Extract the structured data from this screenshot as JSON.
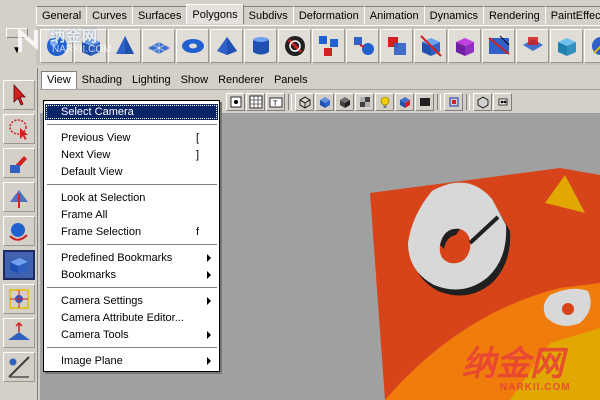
{
  "shelf": {
    "tabs": [
      {
        "label": "General",
        "active": false
      },
      {
        "label": "Curves",
        "active": false
      },
      {
        "label": "Surfaces",
        "active": false
      },
      {
        "label": "Polygons",
        "active": true
      },
      {
        "label": "Subdivs",
        "active": false
      },
      {
        "label": "Deformation",
        "active": false
      },
      {
        "label": "Animation",
        "active": false
      },
      {
        "label": "Dynamics",
        "active": false
      },
      {
        "label": "Rendering",
        "active": false
      },
      {
        "label": "PaintEffects",
        "active": false
      }
    ],
    "icons": [
      "poly-sphere-icon",
      "poly-cube-icon",
      "poly-cone-icon",
      "poly-plane-icon",
      "poly-torus-icon",
      "poly-pyramid-icon",
      "poly-cylinder-icon",
      "poly-combine-icon",
      "poly-extract-icon",
      "poly-smooth-icon",
      "poly-boolean-icon",
      "poly-cut-icon",
      "poly-bevel-icon",
      "poly-split-icon",
      "poly-extrude-icon",
      "poly-merge-icon",
      "poly-sculpt-icon"
    ]
  },
  "panel_menu": {
    "items": [
      "View",
      "Shading",
      "Lighting",
      "Show",
      "Renderer",
      "Panels"
    ],
    "open": "View"
  },
  "view_menu": {
    "groups": [
      [
        {
          "label": "Select Camera",
          "shortcut": "",
          "submenu": false,
          "highlighted": true
        }
      ],
      [
        {
          "label": "Previous View",
          "shortcut": "[",
          "submenu": false
        },
        {
          "label": "Next View",
          "shortcut": "]",
          "submenu": false
        },
        {
          "label": "Default View",
          "shortcut": "",
          "submenu": false
        }
      ],
      [
        {
          "label": "Look at Selection",
          "shortcut": "",
          "submenu": false
        },
        {
          "label": "Frame All",
          "shortcut": "",
          "submenu": false
        },
        {
          "label": "Frame Selection",
          "shortcut": "f",
          "submenu": false
        }
      ],
      [
        {
          "label": "Predefined Bookmarks",
          "shortcut": "",
          "submenu": true
        },
        {
          "label": "Bookmarks",
          "shortcut": "",
          "submenu": true
        }
      ],
      [
        {
          "label": "Camera Settings",
          "shortcut": "",
          "submenu": true
        },
        {
          "label": "Camera Attribute Editor...",
          "shortcut": "",
          "submenu": false
        },
        {
          "label": "Camera Tools",
          "shortcut": "",
          "submenu": true
        }
      ],
      [
        {
          "label": "Image Plane",
          "shortcut": "",
          "submenu": true
        }
      ]
    ]
  },
  "watermark": {
    "top_main": "纳金网",
    "top_sub": "NARKII.COM",
    "bottom_main": "纳金网",
    "bottom_sub": "NARKII.COM"
  },
  "colors": {
    "menu_highlight": "#0a246a",
    "viewport_bg": "#a0a0a0",
    "logo_red": "#d8441a",
    "logo_orange": "#f07c0c",
    "logo_yellow": "#e0a800",
    "logo_white": "#d8d8d8",
    "watermark_red": "#e84038"
  }
}
